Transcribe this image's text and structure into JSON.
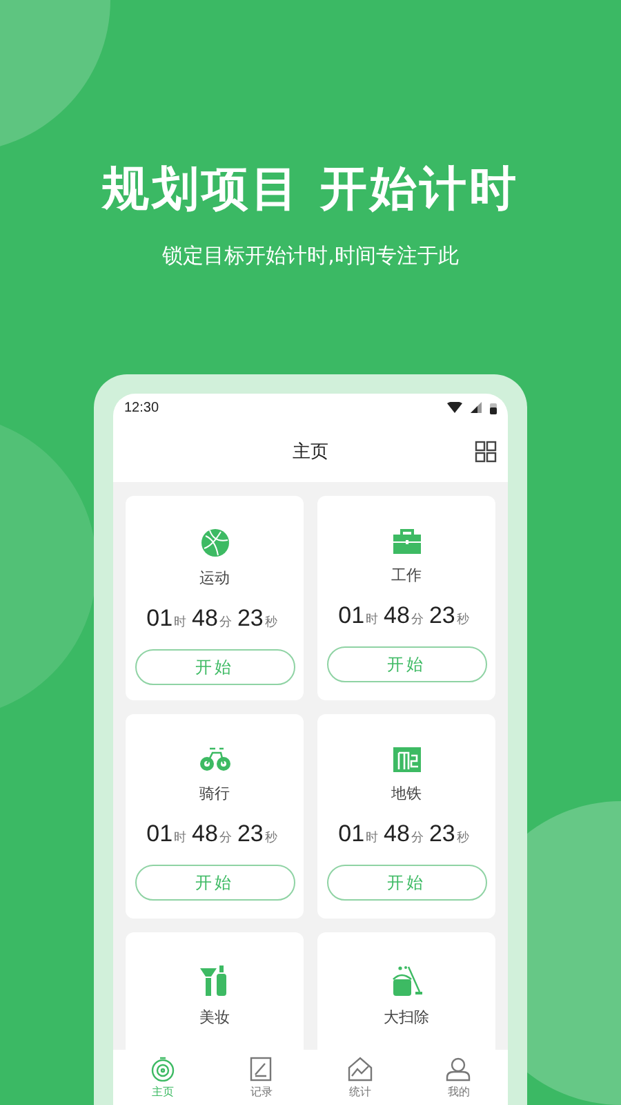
{
  "headline": "规划项目 开始计时",
  "subline": "锁定目标开始计时,时间专注于此",
  "status_bar": {
    "time": "12:30"
  },
  "header": {
    "title": "主页"
  },
  "cards": [
    {
      "name": "运动",
      "time": [
        {
          "value": "01",
          "unit": "时"
        },
        {
          "value": "48",
          "unit": "分"
        },
        {
          "value": "23",
          "unit": "秒"
        }
      ],
      "button": "开始"
    },
    {
      "name": "工作",
      "time": [
        {
          "value": "01",
          "unit": "时"
        },
        {
          "value": "48",
          "unit": "分"
        },
        {
          "value": "23",
          "unit": "秒"
        }
      ],
      "button": "开始"
    },
    {
      "name": "骑行",
      "time": [
        {
          "value": "01",
          "unit": "时"
        },
        {
          "value": "48",
          "unit": "分"
        },
        {
          "value": "23",
          "unit": "秒"
        }
      ],
      "button": "开始"
    },
    {
      "name": "地铁",
      "time": [
        {
          "value": "01",
          "unit": "时"
        },
        {
          "value": "48",
          "unit": "分"
        },
        {
          "value": "23",
          "unit": "秒"
        }
      ],
      "button": "开始"
    },
    {
      "name": "美妆"
    },
    {
      "name": "大扫除"
    }
  ],
  "tab_bar": [
    {
      "label": "主页",
      "selected": true
    },
    {
      "label": "记录",
      "selected": false
    },
    {
      "label": "统计",
      "selected": false
    },
    {
      "label": "我的",
      "selected": false
    }
  ]
}
